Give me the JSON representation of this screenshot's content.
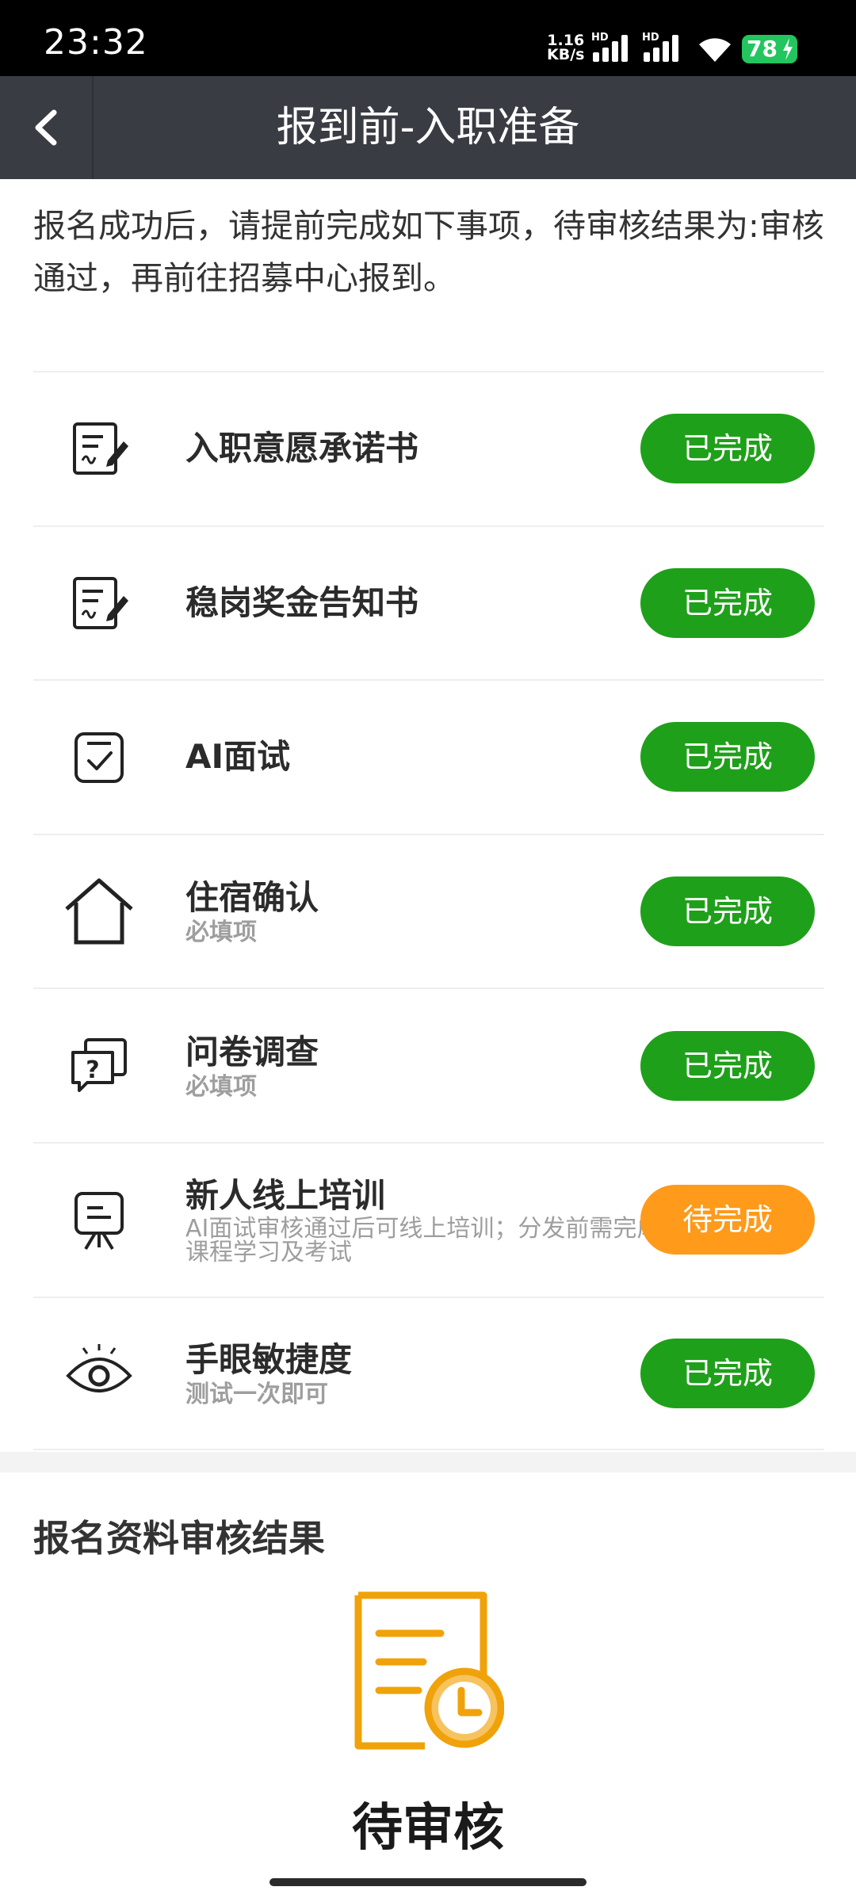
{
  "status_bar": {
    "time": "23:32",
    "net_speed_value": "1.16",
    "net_speed_unit": "KB/s",
    "sim1_label": "HD",
    "sim2_label": "HD",
    "battery": "78"
  },
  "nav": {
    "title": "报到前-入职准备"
  },
  "intro": "报名成功后，请提前完成如下事项，待审核结果为:审核通过，再前往招募中心报到。",
  "tasks": [
    {
      "title": "入职意愿承诺书",
      "subtitle": "",
      "status": "已完成",
      "icon": "document-sign-icon"
    },
    {
      "title": "稳岗奖金告知书",
      "subtitle": "",
      "status": "已完成",
      "icon": "document-sign-icon"
    },
    {
      "title": "AI面试",
      "subtitle": "",
      "status": "已完成",
      "icon": "checkbox-icon"
    },
    {
      "title": "住宿确认",
      "subtitle": "必填项",
      "status": "已完成",
      "icon": "house-icon"
    },
    {
      "title": "问卷调查",
      "subtitle": "必填项",
      "status": "已完成",
      "icon": "question-chat-icon"
    },
    {
      "title": "新人线上培训",
      "subtitle": "AI面试审核通过后可线上培训；分发前需完成课程学习及考试",
      "status": "待完成",
      "icon": "presentation-board-icon"
    },
    {
      "title": "手眼敏捷度",
      "subtitle": "测试一次即可",
      "status": "已完成",
      "icon": "eye-icon"
    }
  ],
  "review": {
    "section_title": "报名资料审核结果",
    "status": "待审核",
    "icon": "document-clock-icon"
  },
  "colors": {
    "done": "#1fa01a",
    "pending": "#ff9a1a",
    "nav_bg": "#393c43",
    "review_icon": "#f0a20a"
  }
}
